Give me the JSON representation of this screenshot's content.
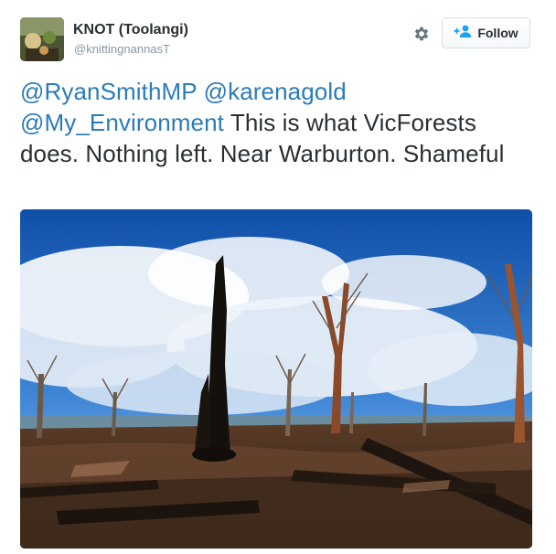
{
  "author": {
    "display_name": "KNOT (Toolangi)",
    "handle": "@knittingnannasT",
    "avatar_icon": "profile-avatar"
  },
  "actions": {
    "settings_icon": "gear-icon",
    "follow_icon": "add-person-icon",
    "follow_label": "Follow"
  },
  "tweet": {
    "mentions": [
      "@RyanSmithMP",
      "@karenagold",
      "@My_Environment"
    ],
    "text": "This is what VicForests does. Nothing left. Near Warburton. Shameful"
  },
  "media": {
    "type": "photo",
    "subject": "burnt forest clearing"
  },
  "colors": {
    "link": "#2b7bb9",
    "text": "#292f33",
    "secondary": "#8899a6",
    "follow_icon": "#1da1f2"
  }
}
